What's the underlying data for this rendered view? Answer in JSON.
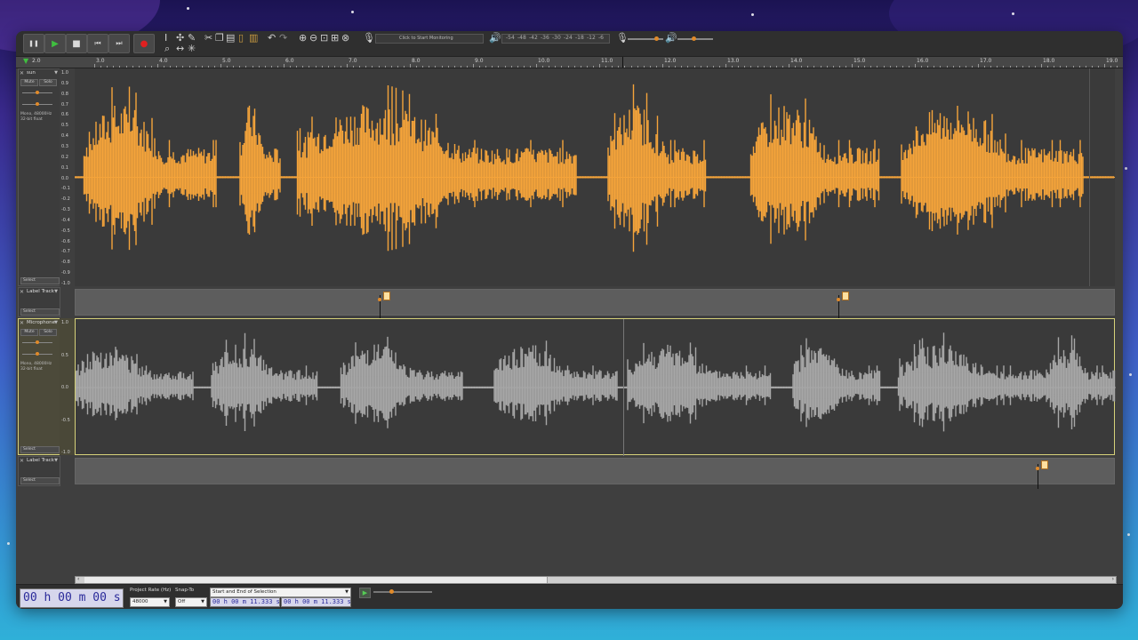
{
  "toolbar": {
    "transport": [
      {
        "id": "pause",
        "icon": "pause-icon",
        "glyph": "❚❚"
      },
      {
        "id": "play",
        "icon": "play-icon",
        "glyph": "▶"
      },
      {
        "id": "stop",
        "icon": "stop-icon",
        "glyph": "■"
      },
      {
        "id": "skip-start",
        "icon": "skip-start-icon",
        "glyph": "⏮"
      },
      {
        "id": "skip-end",
        "icon": "skip-end-icon",
        "glyph": "⏭"
      },
      {
        "id": "record",
        "icon": "record-icon",
        "glyph": "●"
      }
    ],
    "record_meter_ticks": [
      "-54",
      "-48",
      "-42",
      "-36",
      "-30",
      "-24",
      "-18",
      "-12",
      "-6"
    ],
    "record_meter_hint": "Click to Start Monitoring",
    "play_meter_ticks": [
      "-54",
      "-48",
      "-42",
      "-36",
      "-30",
      "-24",
      "-18",
      "-12",
      "-6"
    ]
  },
  "ruler": {
    "labels": [
      "3.0",
      "4.0",
      "5.0",
      "6.0",
      "7.0",
      "8.0",
      "9.0",
      "10.0",
      "11.0",
      "12.0",
      "13.0",
      "14.0",
      "15.0",
      "16.0",
      "17.0",
      "18.0",
      "19.0"
    ],
    "start_label": "2.0"
  },
  "tracks": {
    "audio1": {
      "name": "sun",
      "mute": "Mute",
      "solo": "Solo",
      "info": "Mono, 48000Hz\n32-bit float",
      "select": "Select",
      "scale": [
        "1.0",
        "0.9",
        "0.8",
        "0.7",
        "0.6",
        "0.5",
        "0.4",
        "0.3",
        "0.2",
        "0.1",
        "0.0",
        "-0.1",
        "-0.2",
        "-0.3",
        "-0.4",
        "-0.5",
        "-0.6",
        "-0.7",
        "-0.8",
        "-0.9",
        "-1.0"
      ],
      "color": "#f5a43a"
    },
    "label1": {
      "name": "Label Track",
      "select": "Select"
    },
    "audio2": {
      "name": "Microphone",
      "mute": "Mute",
      "solo": "Solo",
      "info": "Mono, 48000Hz\n32-bit float",
      "select": "Select",
      "scale": [
        "1.0",
        "0.5",
        "0.0",
        "-0.5",
        "-1.0"
      ],
      "color": "#a7a7a7"
    },
    "label2": {
      "name": "Label Track",
      "select": "Select"
    }
  },
  "bottom": {
    "time": "00 h 00 m 00 s",
    "project_rate_label": "Project Rate (Hz)",
    "project_rate": "48000",
    "snap_to_label": "Snap-To",
    "snap_to": "Off",
    "selection_mode": "Start and End of Selection",
    "sel_start": "00 h 00 m 11.333 s",
    "sel_end": "00 h 00 m 11.333 s"
  }
}
